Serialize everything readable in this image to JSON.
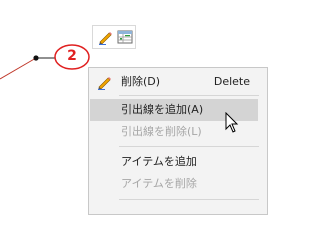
{
  "balloon": {
    "number": "2",
    "color": "#e02020",
    "leader_color": "#c0392b"
  },
  "mini_toolbar": {
    "buttons": [
      {
        "icon": "pencil-edit-icon"
      },
      {
        "icon": "table-properties-icon"
      }
    ]
  },
  "context_menu": {
    "items": [
      {
        "label": "削除(D)",
        "shortcut": "Delete",
        "icon": "pencil-delete-icon",
        "enabled": true,
        "highlighted": false
      },
      {
        "label": "引出線を追加(A)",
        "shortcut": "",
        "enabled": true,
        "highlighted": true
      },
      {
        "label": "引出線を削除(L)",
        "shortcut": "",
        "enabled": false,
        "highlighted": false
      },
      {
        "label": "アイテムを追加",
        "shortcut": "",
        "enabled": true,
        "highlighted": false
      },
      {
        "label": "アイテムを削除",
        "shortcut": "",
        "enabled": false,
        "highlighted": false
      }
    ]
  },
  "colors": {
    "menu_bg": "#f3f3f3",
    "highlight_bg": "#d4d4d4",
    "disabled_text": "#a6a6a6",
    "balloon_red": "#e02020"
  }
}
